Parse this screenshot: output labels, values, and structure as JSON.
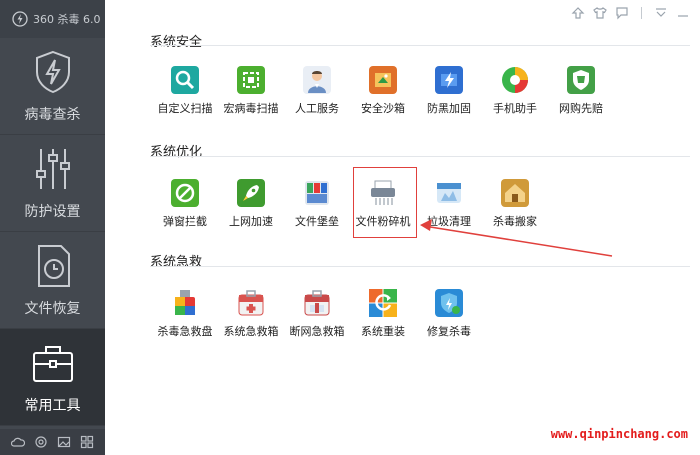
{
  "app": {
    "title": "360 杀毒 6.0"
  },
  "sidebar": {
    "items": [
      {
        "label": "病毒查杀",
        "icon": "shield-bolt-icon",
        "active": false
      },
      {
        "label": "防护设置",
        "icon": "sliders-icon",
        "active": false
      },
      {
        "label": "文件恢复",
        "icon": "file-restore-icon",
        "active": false
      },
      {
        "label": "常用工具",
        "icon": "toolbox-icon",
        "active": true
      }
    ],
    "bottom_icons": [
      "cloud-icon",
      "refresh-icon",
      "image-icon",
      "grid-icon"
    ]
  },
  "window_controls": [
    "upload-icon",
    "shirt-icon",
    "message-icon",
    "dropdown-icon",
    "minimize-icon"
  ],
  "sections": [
    {
      "title": "系统安全",
      "tools": [
        {
          "label": "自定义扫描",
          "icon": "custom-scan-icon",
          "color": "#1ea8a0"
        },
        {
          "label": "宏病毒扫描",
          "icon": "macro-scan-icon",
          "color": "#4caf2f"
        },
        {
          "label": "人工服务",
          "icon": "support-person-icon",
          "color": "#6a8fc4"
        },
        {
          "label": "安全沙箱",
          "icon": "sandbox-icon",
          "color": "#e0702a"
        },
        {
          "label": "防黑加固",
          "icon": "hardening-icon",
          "color": "#2f6fd1"
        },
        {
          "label": "手机助手",
          "icon": "phone-assistant-icon",
          "color": "#39b54a"
        },
        {
          "label": "网购先赔",
          "icon": "shopping-shield-icon",
          "color": "#43a047"
        }
      ]
    },
    {
      "title": "系统优化",
      "tools": [
        {
          "label": "弹窗拦截",
          "icon": "popup-block-icon",
          "color": "#4caf2f"
        },
        {
          "label": "上网加速",
          "icon": "rocket-icon",
          "color": "#3f9b2f"
        },
        {
          "label": "文件堡垒",
          "icon": "file-vault-icon",
          "color": "#5b8ad0"
        },
        {
          "label": "文件粉碎机",
          "icon": "shredder-icon",
          "color": "#7a8797"
        },
        {
          "label": "垃圾清理",
          "icon": "cleanup-icon",
          "color": "#4a90d0"
        },
        {
          "label": "杀毒搬家",
          "icon": "move-house-icon",
          "color": "#d09a3a"
        }
      ]
    },
    {
      "title": "系统急救",
      "tools": [
        {
          "label": "杀毒急救盘",
          "icon": "rescue-usb-icon",
          "color": "#e53935"
        },
        {
          "label": "系统急救箱",
          "icon": "first-aid-kit-icon",
          "color": "#d9534f"
        },
        {
          "label": "断网急救箱",
          "icon": "network-aid-icon",
          "color": "#c94a4a"
        },
        {
          "label": "系统重装",
          "icon": "reinstall-icon",
          "color": "#ee6a2c"
        },
        {
          "label": "修复杀毒",
          "icon": "repair-icon",
          "color": "#2a8bd6"
        }
      ]
    }
  ],
  "watermark": "www.qinpinchang.com"
}
